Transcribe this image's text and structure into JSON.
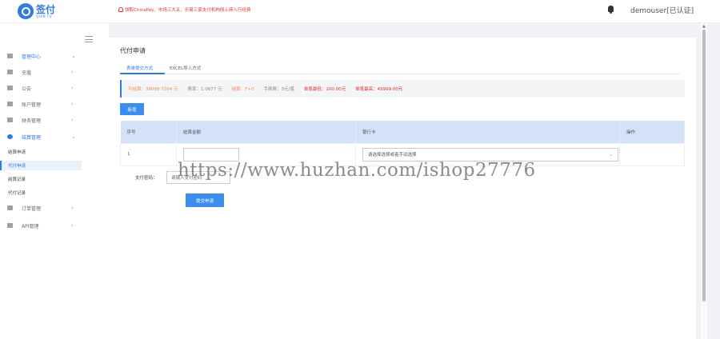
{
  "header": {
    "logo_cn": "签付",
    "logo_en": "QIAN FU",
    "notice": "领取ChinaPay、市场三大五、乐易三家支付机构线上商入行经费",
    "user": "demouser[已认证]"
  },
  "sidebar": {
    "items": [
      {
        "label": "管理中心",
        "icon": "monitor-icon",
        "arrow": "⌄"
      },
      {
        "label": "充值",
        "icon": "card-icon",
        "arrow": "›"
      },
      {
        "label": "公告",
        "icon": "megaphone-icon",
        "arrow": "›"
      },
      {
        "label": "账户管理",
        "icon": "person-icon",
        "arrow": "›"
      },
      {
        "label": "财务管理",
        "icon": "check-icon",
        "arrow": "›"
      },
      {
        "label": "结算管理",
        "icon": "coin-icon",
        "arrow": "⌄"
      },
      {
        "label": "订单管理",
        "icon": "document-icon",
        "arrow": "›"
      },
      {
        "label": "API管理",
        "icon": "share-icon",
        "arrow": "›"
      }
    ],
    "sub_items": [
      {
        "label": "结算申请"
      },
      {
        "label": "代付申请"
      },
      {
        "label": "结算记录"
      },
      {
        "label": "代付记录"
      }
    ]
  },
  "main": {
    "title": "代付申请",
    "tabs": [
      {
        "label": "表单提交方式"
      },
      {
        "label": "EXCEL导入方式"
      }
    ],
    "info": {
      "balance": "可结算：38088.7264 元",
      "rate": "费率：1.0677 元",
      "limit": "结算：T+0",
      "fee": "手续费：3元/笔",
      "min": "单笔最低：100.00元",
      "max": "单笔最高：49999.00元"
    },
    "add_button": "新增",
    "table": {
      "headers": [
        "序号",
        "结算金额",
        "银行卡",
        "操作"
      ],
      "rows": [
        {
          "index": "1",
          "bank_placeholder": "请选择选择或者手动选择"
        }
      ]
    },
    "pay_code_label": "支付密码：",
    "pay_code_placeholder": "请输入支付密码",
    "submit_button": "提交申请"
  },
  "watermark": "https://www.huzhan.com/ishop27776"
}
